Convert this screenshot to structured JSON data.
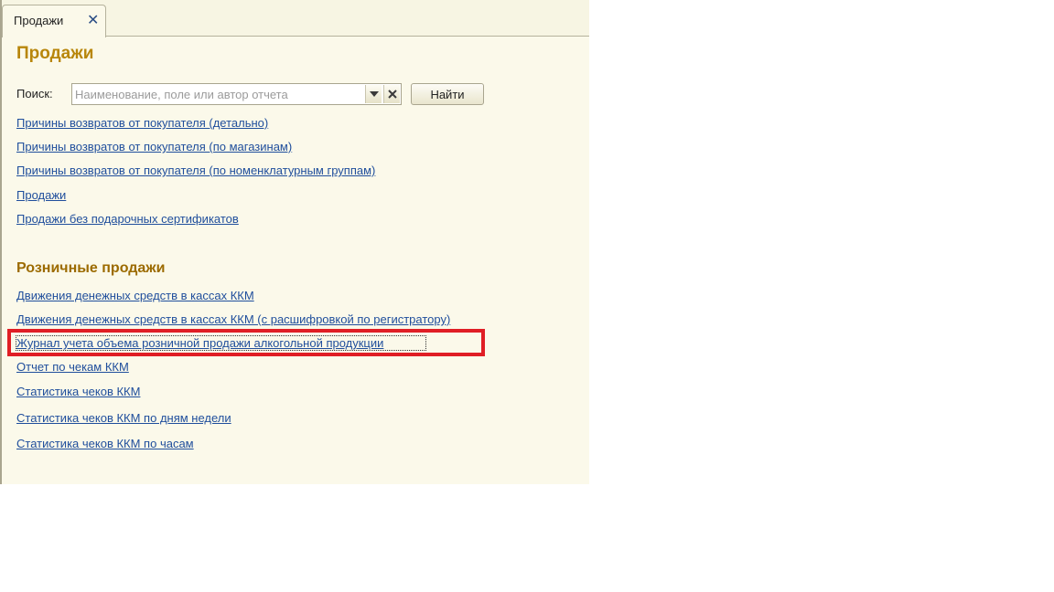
{
  "tab": {
    "label": "Продажи",
    "close_glyph": "✕"
  },
  "page_title": "Продажи",
  "search": {
    "label": "Поиск:",
    "value": "",
    "placeholder": "Наименование, поле или автор отчета",
    "dropdown_icon": "chevron-down-icon",
    "clear_icon": "clear-x-icon",
    "find_label": "Найти"
  },
  "sales_links": [
    "Причины возвратов от покупателя (детально)",
    "Причины возвратов от покупателя (по магазинам)",
    "Причины возвратов от покупателя (по номенклатурным группам)",
    "Продажи",
    "Продажи без подарочных сертификатов"
  ],
  "retail_section": {
    "title": "Розничные продажи",
    "links": [
      "Движения денежных средств в кассах ККМ",
      "Движения денежных средств в кассах ККМ (с расшифровкой по регистратору)",
      "Журнал учета объема розничной продажи алкогольной продукции",
      "Отчет по чекам ККМ",
      "Статистика чеков ККМ",
      "Статистика чеков ККМ по дням недели",
      "Статистика чеков ККМ по часам"
    ]
  },
  "colors": {
    "title_gold": "#b8860b",
    "section_gold": "#9c6b00",
    "link_blue": "#1f4e9c",
    "highlight_red": "#e01e25",
    "window_bg": "#fbf9ea"
  }
}
